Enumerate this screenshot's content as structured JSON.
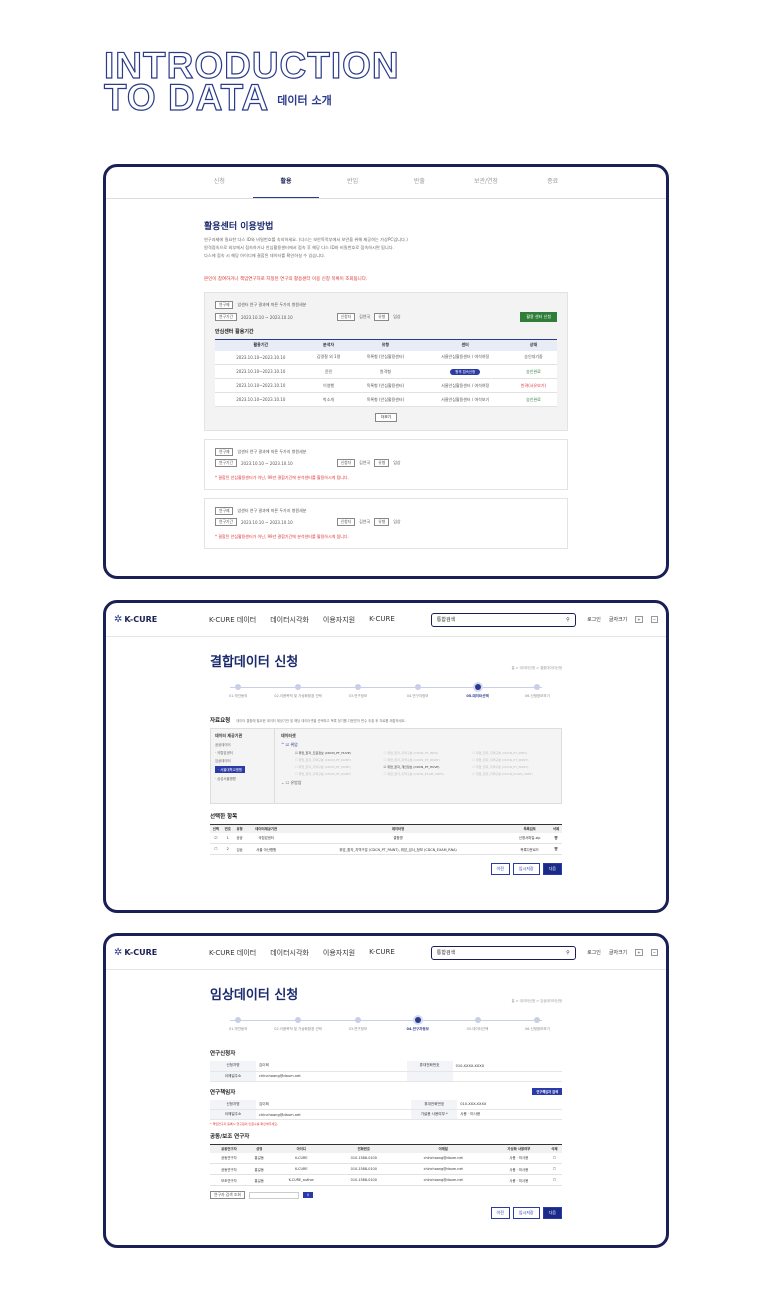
{
  "hero": {
    "line1": "INTRODUCTION",
    "line2": "TO DATA",
    "subtitle": "데이터 소개"
  },
  "f1": {
    "tabs": [
      "신청",
      "활용",
      "반입",
      "반출",
      "보관/연장",
      "종료"
    ],
    "active_tab": 1,
    "title": "활용센터 이용방법",
    "desc": [
      "연구과제에 필요한 다스 ID와 비밀번호를 숙지하세요. (다스는 보안목적부에서 보안을 위해 제공하는 가상PC입니다.)",
      "원격접속으로 외부에서 접속하거나 안심활용센터에서 접속 후 해당 다스 ID와 비밀번호로 접속하시면 됩니다.",
      "다스에 접속 시 해당 아이디에 결합된 데이터를 확인하실 수 있습니다."
    ],
    "notice": "본인이 참여하거나 책임연구자로 지정된 연구의 활용센터 이용 신청 목록이 조회됩니다.",
    "card_label": "연구제",
    "card_title": "암센터 연구 결과에 따른 두가지 병원세분",
    "period_label": "연구기간",
    "period": "2023.10.10 ~ 2023.10.10",
    "r_label": "신청자",
    "r_name": "김연국",
    "s_label": "유형",
    "s_val": "임상",
    "apply_btn": "활용 센터 신청",
    "table_title": "안심센터 활용기간",
    "cols": [
      "활용기간",
      "분석자",
      "유형",
      "센터",
      "상태"
    ],
    "rows": [
      [
        "2023.10.10~2023.10.10",
        "김명철 외 1명",
        "목록형 (안심활용센터)",
        "서울안심활용센터 / 여석여정",
        "승인대기중"
      ],
      [
        "2023.10.10~2023.10.10",
        "윤민",
        "원격형",
        "원격 접속신청",
        "승인완료"
      ],
      [
        "2023.10.10~2023.10.10",
        "이영행",
        "목록형 (안심활용센터)",
        "서울안심활용센터 / 여석여정",
        "반려(사유보기)"
      ],
      [
        "2023.10.10~2023.10.10",
        "박소개",
        "목록형 (안심활용센터)",
        "서울안심활용센터 / 여석보기",
        "승인완료"
      ]
    ],
    "more": "더보기",
    "warn": "* 결합된 안심활용센터가 아닌, 99년 결합기간에 분석센터를 활용하시게 됩니다."
  },
  "nav": {
    "logo": "K-CURE",
    "menu": [
      "K-CURE 데이터",
      "데이터시각화",
      "이용자지원",
      "K-CURE"
    ],
    "search": "통합검색",
    "login": "로그인",
    "font": "글자크기"
  },
  "f2": {
    "title": "결합데이터 신청",
    "crumb": "홈 > 데이터신청 > 결합데이터신청",
    "steps": [
      "01.약관동의",
      "02.이용목적 및 가상화환경 선택",
      "03.연구정보",
      "04.연구자정보",
      "05.데이터선택",
      "06.신청정보보기"
    ],
    "on": 4,
    "sec": "자료요청",
    "sec_desc": "데이터 결합에 필요한 데이터 제공기관 및 해당 데이터셋을 선택하고 목록 정기를 다운받아 변수 추출 후 자료를 제출하세요.",
    "left_h": "데이터 제공기관",
    "left_items": [
      "공공데이터",
      "· 국립암센터",
      "임상데이터",
      "· 서울대학교병원",
      "· 삼성서울병원"
    ],
    "right_h": "데이터셋",
    "grp": "위암",
    "items": [
      "위암_환자_진료정보 (CDCN_PT_HUVP)",
      "위암_환자_지역구분 (CDCN_PT_INFO)",
      "위암_환자_지역구분 (CDCN_PT_INFO)",
      "위암_환자_지역구분 (CDCN_PT_PAINT)",
      "위암_환자_지역구분 (CDCN_PT_PAINT)",
      "위암_환자_지역구분 (CDCN_PT_PAINT)",
      "위암_환자_지역구분 (CDCN_PT_PAINT)",
      "위암_환자_개인정보 (CDCN_PT_HUVP)",
      "위암_환자_지역구분 (CDCN_PT_PAINT)",
      "위암_환자_지역구분 (CDCN_PT_PAINT)",
      "위암_환자_지역구분 (CDCN_EXAM_URPT)",
      "위암_환자_지역구분 (CDCN_EXAM_URPT)"
    ],
    "grp2": "유방암",
    "sel_title": "선택한 항목",
    "sel_cols": [
      "선택",
      "번호",
      "유형",
      "데이터제공기관",
      "데이터명",
      "목록검토",
      "삭제"
    ],
    "sel_rows": [
      [
        "1",
        "공공",
        "국립암센터",
        "결합명",
        "신청서파일.zip"
      ],
      [
        "2",
        "임상",
        "서울 아산병원",
        "위암_환자_지역구분 (CDCN_PT_PAINT), 위암_검사_정보 (CDCN_EXAM_RNA)",
        "목록다운로드"
      ]
    ],
    "btns": [
      "이전",
      "임시저장",
      "다음"
    ]
  },
  "f3": {
    "title": "임상데이터 신청",
    "crumb": "홈 > 데이터신청 > 임상데이터신청",
    "on": 3,
    "steps": [
      "01.약관동의",
      "02.이용목적 및 가상화환경 선택",
      "03.연구정보",
      "04.연구자정보",
      "05.데이터선택",
      "06.신청정보보기"
    ],
    "applicant": "연구신청자",
    "ap_rows": [
      [
        "신청자명",
        "김이희",
        "휴대전화번호",
        "010-XXXX-XXXX"
      ],
      [
        "이메일주소",
        "chlnchoang@daum.net",
        "",
        ""
      ]
    ],
    "resp": "연구책임자",
    "resp_btn": "연구책임자 검색",
    "rs_rows": [
      [
        "신청자명",
        "김이희",
        "휴대전화번호",
        "010-XXX-XXXX"
      ],
      [
        "이메일주소",
        "chlnchoang@daum.net",
        "가설용 사용여부 *",
        "사용 · 미사용"
      ]
    ],
    "note": "* 책임연구자 등록시 연구원의 인원수를 확인해주세요.",
    "co": "공동/보조 연구자",
    "co_cols": [
      "공동연구자",
      "성명",
      "아이디",
      "전화번호",
      "이메일",
      "가상화 사용여부",
      "삭제"
    ],
    "co_rows": [
      [
        "공동연구자",
        "홍길동",
        "K-CURE",
        "010-1588-0100",
        "chlnchoang@daum.net",
        "사용 · 미사용"
      ],
      [
        "공동연구자",
        "홍길동",
        "K-CURE",
        "010-1588-0100",
        "chlnchoang@daum.net",
        "사용 · 미사용"
      ],
      [
        "보조연구자",
        "홍길동",
        "K-CURE_author",
        "010-1588-0100",
        "chlnchoang@daum.net",
        "사용 · 미사용"
      ]
    ],
    "search_label": "연구자 검색 조회",
    "btns": [
      "이전",
      "임시저장",
      "다음"
    ]
  }
}
